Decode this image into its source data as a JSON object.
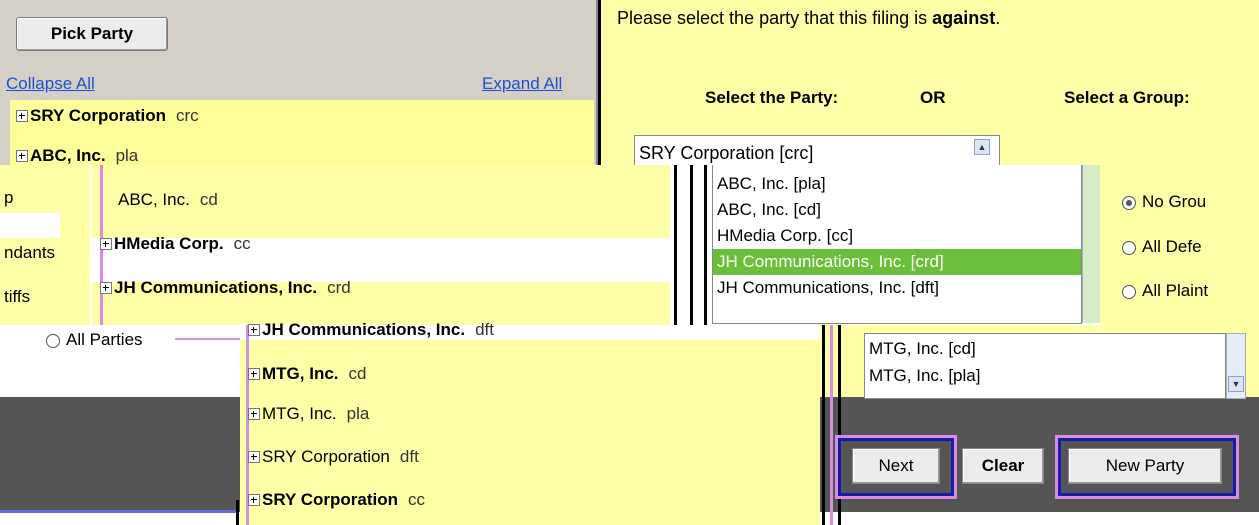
{
  "header": {
    "pick_party": "Pick Party",
    "collapse_all": "Collapse All",
    "expand_all": "Expand All",
    "instruction_prefix": "Please select the party that this filing is ",
    "instruction_bold": "against",
    "instruction_suffix": ".",
    "select_party": "Select the Party:",
    "or": "OR",
    "select_group": "Select a Group:"
  },
  "tree_top": [
    {
      "name": "SRY Corporation",
      "code": "crc"
    },
    {
      "name": "ABC, Inc.",
      "code": "pla"
    }
  ],
  "tree_mid": [
    {
      "name": "ABC, Inc.",
      "code": "cd"
    },
    {
      "name": "HMedia Corp.",
      "code": "cc"
    },
    {
      "name": "JH Communications, Inc.",
      "code": "crd"
    }
  ],
  "left_fragments": [
    "p",
    "ndants",
    "tiffs"
  ],
  "all_parties": "All Parties",
  "tree_bottom": [
    {
      "name": "JH Communications, Inc.",
      "code": "dft"
    },
    {
      "name": "MTG, Inc.",
      "code": "cd"
    },
    {
      "name": "MTG, Inc.",
      "code": "pla"
    },
    {
      "name": "SRY Corporation",
      "code": "dft"
    },
    {
      "name": "SRY Corporation",
      "code": "cc"
    }
  ],
  "party_list_top": "SRY Corporation [crc]",
  "party_list_mid": [
    {
      "label": "ABC, Inc. [pla]",
      "selected": false
    },
    {
      "label": "ABC, Inc. [cd]",
      "selected": false
    },
    {
      "label": "HMedia Corp. [cc]",
      "selected": false
    },
    {
      "label": "JH Communications, Inc. [crd]",
      "selected": true
    },
    {
      "label": "JH Communications, Inc. [dft]",
      "selected": false
    }
  ],
  "party_list_bottom": [
    "MTG, Inc. [cd]",
    "MTG, Inc. [pla]"
  ],
  "groups": [
    {
      "label": "No Grou",
      "checked": true
    },
    {
      "label": "All Defe",
      "checked": false
    },
    {
      "label": "All Plaint",
      "checked": false
    }
  ],
  "buttons": {
    "next": "Next",
    "clear": "Clear",
    "new_party": "New Party"
  },
  "colors": {
    "selected_green": "#6cbf3a",
    "yellow_bg": "#ffffa8",
    "link_blue": "#1f4fcf",
    "highlight_blue": "#1a1aa8"
  }
}
